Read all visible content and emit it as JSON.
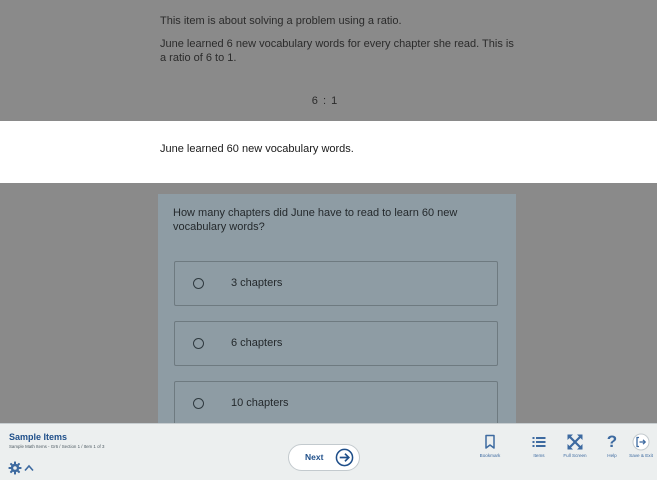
{
  "passage": {
    "intro": "This item is about solving a problem using a ratio.",
    "body": "June learned 6 new vocabulary words for every chapter she read. This is a ratio of 6 to 1.",
    "ratio": "6 : 1",
    "highlight": "June learned 60 new vocabulary words."
  },
  "question": {
    "prompt": "How many chapters did June have to read to learn 60 new vocabulary words?",
    "options": [
      {
        "label": "3 chapters"
      },
      {
        "label": "6 chapters"
      },
      {
        "label": "10 chapters"
      }
    ]
  },
  "footer": {
    "title": "Sample Items",
    "subtitle": "Sample Math Items - Gr6 / Section 1 / Item 1 of 3",
    "next_label": "Next",
    "tools": [
      {
        "label": "Bookmark",
        "icon": "bookmark-icon"
      },
      {
        "label": "Items",
        "icon": "list-icon"
      },
      {
        "label": "Full Screen",
        "icon": "fullscreen-icon"
      },
      {
        "label": "Help",
        "icon": "help-icon"
      },
      {
        "label": "Save & Exit",
        "icon": "exit-icon"
      }
    ]
  },
  "colors": {
    "overlay": "#8a8a8a",
    "highlight": "#ffffff",
    "accent": "#1f4f8a",
    "footer": "#ecefef"
  }
}
